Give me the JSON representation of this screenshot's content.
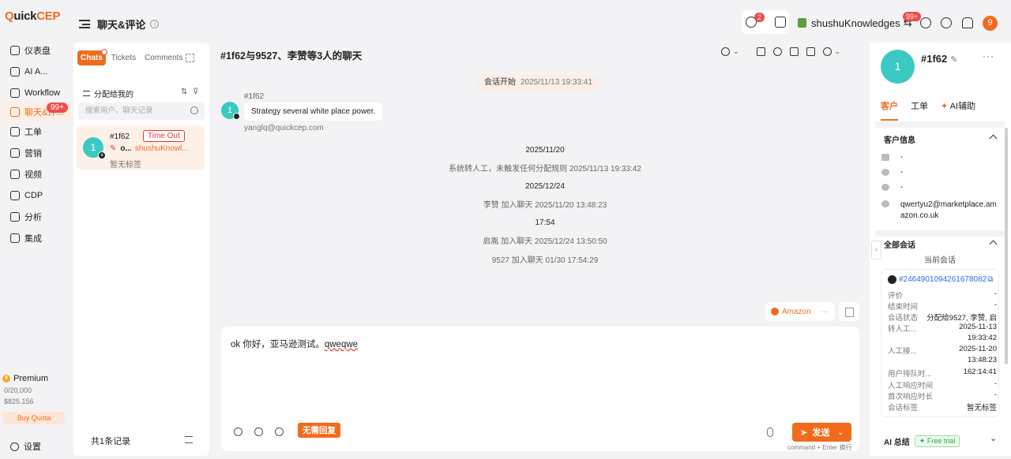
{
  "app": {
    "logo_q": "Q",
    "logo_text": "uick",
    "logo_cep": "CEP"
  },
  "nav": {
    "items": [
      {
        "label": "仪表盘"
      },
      {
        "label": "AI A..."
      },
      {
        "label": "Workflow"
      },
      {
        "label": "聊天&评..."
      },
      {
        "label": "工单"
      },
      {
        "label": "营销"
      },
      {
        "label": "视频"
      },
      {
        "label": "CDP"
      },
      {
        "label": "分析"
      },
      {
        "label": "集成"
      }
    ],
    "chat_badge": "99+",
    "premium": {
      "label": "Premium",
      "usage": "0/20,000",
      "balance": "$825.156",
      "buy_quota": "Buy Quota"
    },
    "settings": "设置"
  },
  "header": {
    "title": "聊天&评论",
    "info_icon": "i",
    "agent_badge": "2",
    "store_name": "shushuKnowledges",
    "store_badge": "99+",
    "avatar": "9"
  },
  "list": {
    "tabs": [
      "Chats",
      "Tickets",
      "Comments"
    ],
    "assigned_label": "分配给我的",
    "search_placeholder": "搜索用户、聊天记录",
    "conversations": [
      {
        "avatar": "1",
        "name": "#1f62",
        "status": "Time Out",
        "preview": "o...",
        "store": "shushuKnowl...",
        "tag": "暂无标签"
      }
    ],
    "footer": "共1条记录"
  },
  "chat": {
    "title": "#1f62与9527、李赞等3人的聊天",
    "session_start_label": "会话开始",
    "session_start_time": "2025/11/13 19:33:41",
    "sender": "#1f62",
    "sender_avatar": "1",
    "message": "Strategy several white place power.",
    "sender_email": "yanglq@quickcep.com",
    "events": [
      {
        "text": "2025/11/20",
        "kind": "date"
      },
      {
        "text": "系统转人工，未触发任何分配规则  2025/11/13 19:33:42",
        "kind": "event"
      },
      {
        "text": "2025/12/24",
        "kind": "date"
      },
      {
        "text": "李赞 加入聊天  2025/11/20 13:48:23",
        "kind": "event"
      },
      {
        "text": "17:54",
        "kind": "date"
      },
      {
        "text": "启胤 加入聊天  2025/12/24 13:50:50",
        "kind": "event"
      },
      {
        "text": "9527 加入聊天  01/30 17:54:29",
        "kind": "event"
      }
    ],
    "channel": "Amazon",
    "channel_more": "···",
    "composer_text_a": "ok 你好，亚马逊测试。",
    "composer_text_b": "qweqwe",
    "no_reply": "无需回复",
    "send": "发送",
    "send_hint": "command + Enter 换行"
  },
  "customer": {
    "avatar": "1",
    "name": "#1f62",
    "tabs": [
      "客户",
      "工单",
      "AI辅助"
    ],
    "info_title": "客户信息",
    "email": "-",
    "phone": "-",
    "whatsapp": "-",
    "amazon_email": "qwertyu2@marketplace.amazon.co.uk",
    "all_sessions_title": "全部会话",
    "current_session": "当前会话",
    "session_id": "#2464901094261678082",
    "rows": [
      {
        "k": "评价",
        "v": "-"
      },
      {
        "k": "结束时间",
        "v": "-"
      },
      {
        "k": "会话状态",
        "v": "分配给9527, 李赞, 启"
      },
      {
        "k": "转人工...",
        "v": "2025-11-13"
      },
      {
        "k": "",
        "v": "19:33:42"
      },
      {
        "k": "人工接...",
        "v": "2025-11-20"
      },
      {
        "k": "",
        "v": "13:48:23"
      },
      {
        "k": "用户排队时...",
        "v": "162:14:41"
      },
      {
        "k": "人工响应时间",
        "v": "-"
      },
      {
        "k": "首次响应时长",
        "v": "-"
      },
      {
        "k": "会话标签",
        "v": "暂无标签"
      }
    ],
    "ai_summary": "AI 总结",
    "free_trial": "Free trial"
  },
  "colors": {
    "accent": "#f26b1d",
    "teal_avatar": "#3cc9c2",
    "badge_red": "#f04b4b",
    "link_blue": "#2f6fde"
  }
}
